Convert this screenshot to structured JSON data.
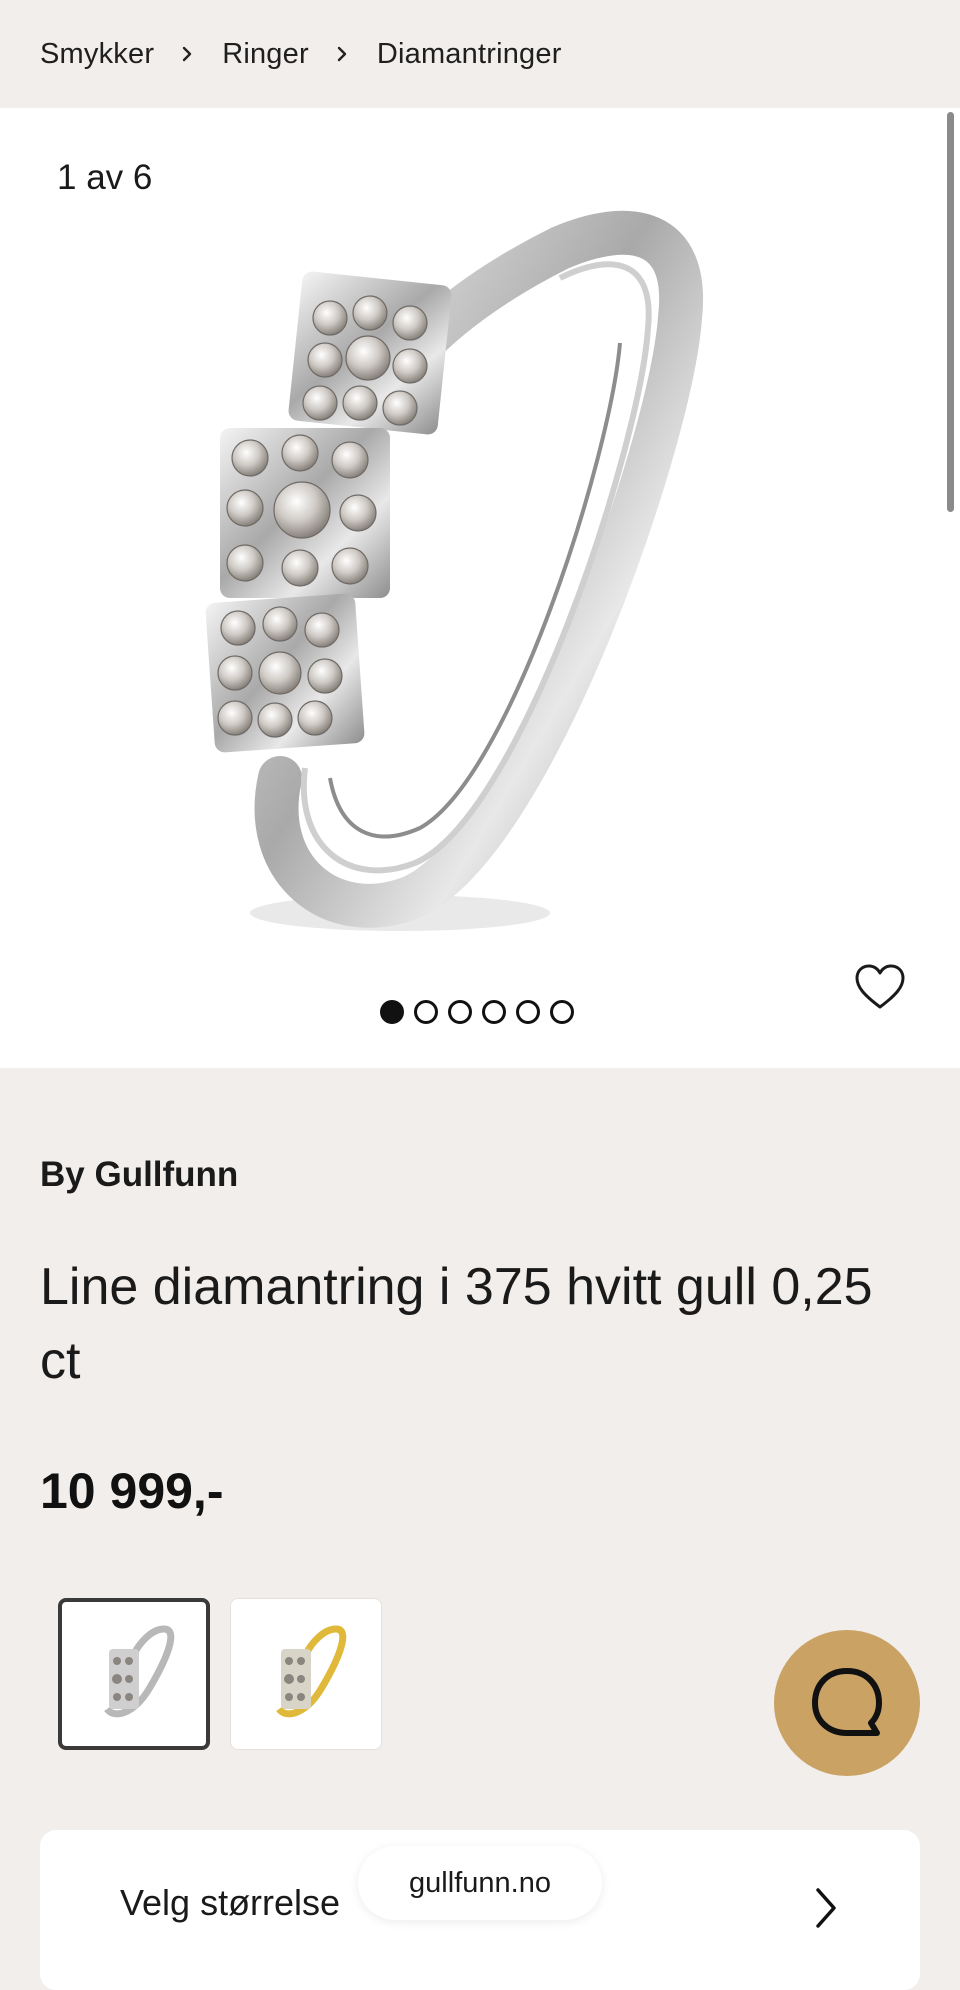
{
  "breadcrumb": {
    "items": [
      "Smykker",
      "Ringer",
      "Diamantringer"
    ]
  },
  "gallery": {
    "counter": "1 av 6",
    "dots_total": 6,
    "dots_active_index": 0,
    "favorite_icon": "heart-outline-icon"
  },
  "product": {
    "brand": "By Gullfunn",
    "title": "Line diamantring i 375 hvitt gull 0,25 ct",
    "price": "10 999,-"
  },
  "variants": [
    {
      "metal": "white gold",
      "selected": true
    },
    {
      "metal": "yellow gold",
      "selected": false
    }
  ],
  "chat": {
    "icon": "chat-bubble-icon",
    "color": "#c9a264"
  },
  "size_selector": {
    "label": "Velg størrelse",
    "icon": "chevron-right-icon"
  },
  "browser": {
    "domain": "gullfunn.no"
  },
  "colors": {
    "background": "#f2eeeb",
    "accent": "#c9a264",
    "text": "#1a1a1a"
  }
}
